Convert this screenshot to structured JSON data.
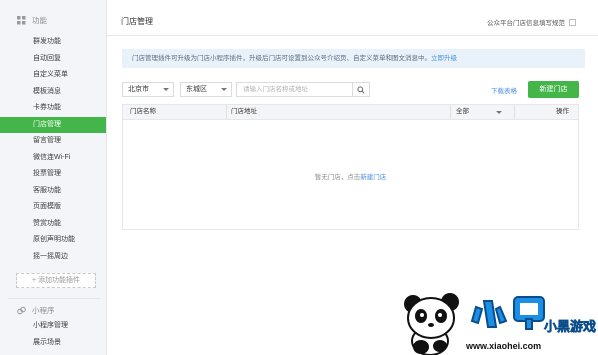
{
  "sidebar": {
    "group_feature": "功能",
    "items": [
      "群发功能",
      "自动回复",
      "自定义菜单",
      "模板消息",
      "卡券功能",
      "门店管理",
      "留言管理",
      "微信连Wi-Fi",
      "投票管理",
      "客服功能",
      "页面模版",
      "赞赏功能",
      "原创声明功能",
      "摇一摇周边"
    ],
    "active_index": 5,
    "add_plugin": "+ 添加功能插件",
    "group_miniapp": "小程序",
    "miniapp_items": [
      "小程序管理",
      "展示场景"
    ]
  },
  "main": {
    "title": "门店管理",
    "spec_link": "公众平台门店信息填写规范"
  },
  "notice": {
    "text": "门店管理插件可升级为门店小程序插件，升级后门店可设置到公众号介绍页、自定义菜单和图文消息中。",
    "link": "立即升级"
  },
  "filters": {
    "city": "北京市",
    "district": "东城区",
    "search_placeholder": "请输入门店名称或地址"
  },
  "actions": {
    "download": "下载表格",
    "new_store": "新建门店"
  },
  "table": {
    "columns": [
      "门店名称",
      "门店地址",
      "全部",
      "操作"
    ],
    "empty_text": "暂无门店，点击",
    "empty_link": "新建门店"
  },
  "watermark": {
    "brand": "小黑游戏",
    "url": "www.xiaohei.com"
  },
  "colors": {
    "accent_green": "#44b549",
    "link_blue": "#4a8fe0",
    "notice_bg": "#e9f1fb",
    "sidebar_bg": "#f4f5f9"
  }
}
